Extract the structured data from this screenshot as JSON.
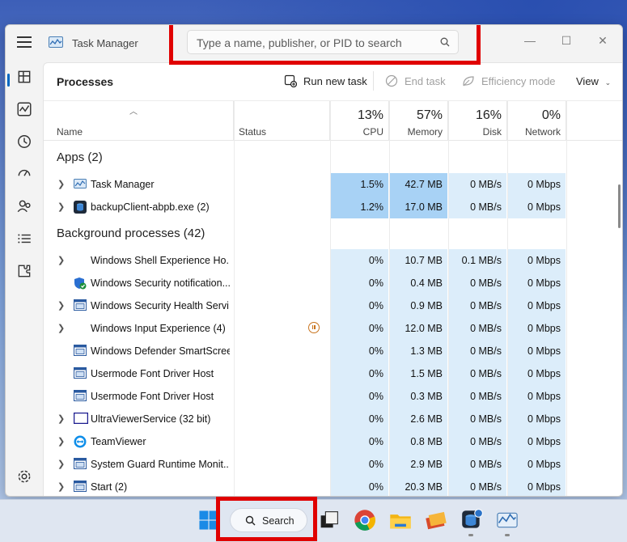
{
  "window": {
    "title": "Task Manager",
    "search_placeholder": "Type a name, publisher, or PID to search"
  },
  "toolbar": {
    "page_title": "Processes",
    "run_new_task": "Run new task",
    "end_task": "End task",
    "efficiency_mode": "Efficiency mode",
    "view": "View"
  },
  "columns": {
    "name": "Name",
    "status": "Status",
    "cpu": {
      "pct": "13%",
      "label": "CPU"
    },
    "memory": {
      "pct": "57%",
      "label": "Memory"
    },
    "disk": {
      "pct": "16%",
      "label": "Disk"
    },
    "network": {
      "pct": "0%",
      "label": "Network"
    }
  },
  "groups": {
    "apps": "Apps (2)",
    "background": "Background processes (42)"
  },
  "apps": [
    {
      "name": "Task Manager",
      "cpu": "1.5%",
      "mem": "42.7 MB",
      "disk": "0 MB/s",
      "net": "0 Mbps",
      "icon": "task-manager-icon",
      "expand": true
    },
    {
      "name": "backupClient-abpb.exe (2)",
      "cpu": "1.2%",
      "mem": "17.0 MB",
      "disk": "0 MB/s",
      "net": "0 Mbps",
      "icon": "backup-client-icon",
      "expand": true
    }
  ],
  "background": [
    {
      "name": "Windows Shell Experience Ho...",
      "cpu": "0%",
      "mem": "10.7 MB",
      "disk": "0.1 MB/s",
      "net": "0 Mbps",
      "icon": "none",
      "expand": true
    },
    {
      "name": "Windows Security notification...",
      "cpu": "0%",
      "mem": "0.4 MB",
      "disk": "0 MB/s",
      "net": "0 Mbps",
      "icon": "security-shield-icon",
      "expand": false
    },
    {
      "name": "Windows Security Health Servi...",
      "cpu": "0%",
      "mem": "0.9 MB",
      "disk": "0 MB/s",
      "net": "0 Mbps",
      "icon": "app-window-icon",
      "expand": true
    },
    {
      "name": "Windows Input Experience (4)",
      "cpu": "0%",
      "mem": "12.0 MB",
      "disk": "0 MB/s",
      "net": "0 Mbps",
      "icon": "none",
      "expand": true,
      "suspended": true
    },
    {
      "name": "Windows Defender SmartScreen",
      "cpu": "0%",
      "mem": "1.3 MB",
      "disk": "0 MB/s",
      "net": "0 Mbps",
      "icon": "app-window-icon",
      "expand": false
    },
    {
      "name": "Usermode Font Driver Host",
      "cpu": "0%",
      "mem": "1.5 MB",
      "disk": "0 MB/s",
      "net": "0 Mbps",
      "icon": "app-window-icon",
      "expand": false
    },
    {
      "name": "Usermode Font Driver Host",
      "cpu": "0%",
      "mem": "0.3 MB",
      "disk": "0 MB/s",
      "net": "0 Mbps",
      "icon": "app-window-icon",
      "expand": false
    },
    {
      "name": "UltraViewerService (32 bit)",
      "cpu": "0%",
      "mem": "2.6 MB",
      "disk": "0 MB/s",
      "net": "0 Mbps",
      "icon": "ultraviewer-icon",
      "expand": true
    },
    {
      "name": "TeamViewer",
      "cpu": "0%",
      "mem": "0.8 MB",
      "disk": "0 MB/s",
      "net": "0 Mbps",
      "icon": "teamviewer-icon",
      "expand": true
    },
    {
      "name": "System Guard Runtime Monit...",
      "cpu": "0%",
      "mem": "2.9 MB",
      "disk": "0 MB/s",
      "net": "0 Mbps",
      "icon": "app-window-icon",
      "expand": true
    },
    {
      "name": "Start (2)",
      "cpu": "0%",
      "mem": "20.3 MB",
      "disk": "0 MB/s",
      "net": "0 Mbps",
      "icon": "app-window-icon",
      "expand": true
    }
  ],
  "taskbar": {
    "search_label": "Search"
  }
}
